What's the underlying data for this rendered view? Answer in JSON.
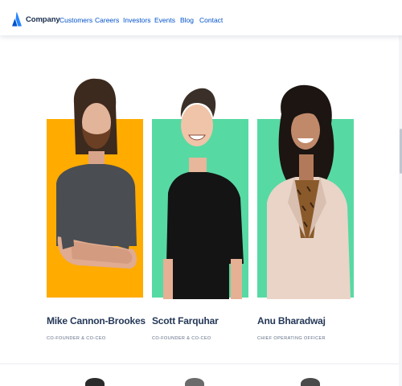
{
  "nav": {
    "brand": "Company",
    "links": [
      "Customers",
      "Careers",
      "Investors",
      "Events",
      "Blog",
      "Contact"
    ]
  },
  "colors": {
    "brand_blue": "#2684ff",
    "link_blue": "#0052cc",
    "card_yellow": "#ffab00",
    "card_green": "#57d9a3",
    "name_color": "#253858",
    "title_color": "#5e6c84"
  },
  "leaders": [
    {
      "name": "Mike Cannon-Brookes",
      "title": "CO-FOUNDER & CO-CEO",
      "bg": "#ffab00"
    },
    {
      "name": "Scott Farquhar",
      "title": "CO-FOUNDER & CO-CEO",
      "bg": "#57d9a3"
    },
    {
      "name": "Anu Bharadwaj",
      "title": "CHIEF OPERATING OFFICER",
      "bg": "#57d9a3"
    }
  ]
}
